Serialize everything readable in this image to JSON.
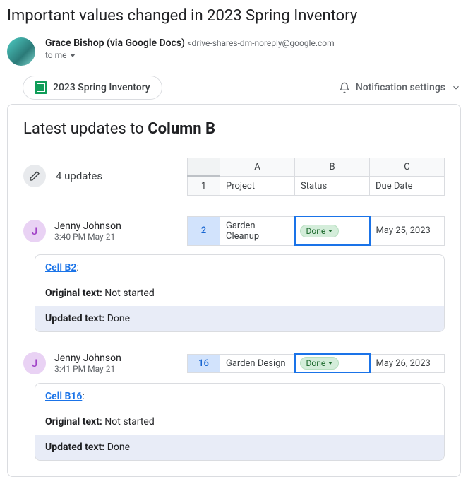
{
  "heading": "Important values changed in 2023 Spring Inventory",
  "sender": {
    "name": "Grace Bishop (via Google Docs)",
    "email": "<drive-shares-dm-noreply@google.com",
    "to_label": "to me"
  },
  "doc_chip": "2023 Spring Inventory",
  "notification_label": "Notification settings",
  "latest": {
    "prefix": "Latest updates to ",
    "column": "Column B"
  },
  "updates_count": "4 updates",
  "header_table": {
    "cols": [
      "A",
      "B",
      "C"
    ],
    "row1_num": "1",
    "row1": [
      "Project",
      "Status",
      "Due Date"
    ]
  },
  "updates": [
    {
      "avatar_initial": "J",
      "user": "Jenny Johnson",
      "time": "3:40 PM May 21",
      "row_num": "2",
      "cellA": "Garden Cleanup",
      "cellB_status": "Done",
      "cellC": "May 25, 2023",
      "cell_ref": "Cell B2",
      "original_label": "Original text:",
      "original_value": " Not started",
      "updated_label": "Updated text:",
      "updated_value": " Done"
    },
    {
      "avatar_initial": "J",
      "user": "Jenny Johnson",
      "time": "3:41 PM May 21",
      "row_num": "16",
      "cellA": "Garden Design",
      "cellB_status": "Done",
      "cellC": "May 26, 2023",
      "cell_ref": "Cell B16",
      "original_label": "Original text:",
      "original_value": " Not started",
      "updated_label": "Updated text:",
      "updated_value": " Done"
    }
  ]
}
